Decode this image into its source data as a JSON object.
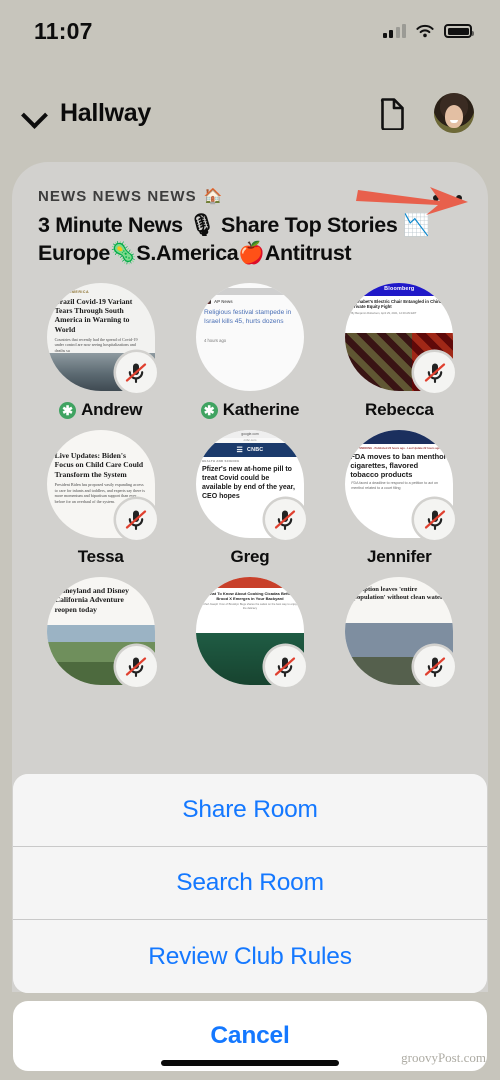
{
  "status_bar": {
    "time": "11:07",
    "signal_icon": "cellular-bars-icon",
    "wifi_icon": "wifi-icon",
    "battery_icon": "battery-full-icon"
  },
  "nav": {
    "chevron_icon": "chevron-down-icon",
    "room_label": "Hallway",
    "document_icon": "document-icon",
    "avatar_icon": "user-avatar"
  },
  "room": {
    "club_name": "NEWS NEWS NEWS",
    "club_house_emoji": "🏠",
    "title": "3 Minute News 🎙 Share Top Stories 📉Europe🦠S.America🍎Antitrust",
    "more_icon": "ellipsis-more-icon",
    "arrow_annotation_color": "#e8604c",
    "club_badge_color": "#3fa361",
    "accent_color": "#1478ff"
  },
  "participants": [
    {
      "name": "Andrew",
      "club_member": true,
      "muted": true,
      "card": {
        "kicker": "LATIN AMERICA",
        "headline": "Brazil Covid-19 Variant Tears Through South America in Warning to World",
        "body": "Countries that recently had the spread of Covid-19 under control are now seeing hospitalizations and deaths su",
        "style": "serif"
      }
    },
    {
      "name": "Katherine",
      "club_member": true,
      "muted": false,
      "card": {
        "source": "AP News",
        "headline": "Religious festival stampede in Israel kills 45, hurts dozens",
        "timestamp": "4 hours ago",
        "style": "link"
      }
    },
    {
      "name": "Rebecca",
      "club_member": false,
      "muted": true,
      "card": {
        "brand": "Bloomberg",
        "headline": "Alphabet's Electric Chair Entangled in China Private Equity Fight",
        "byline": "By Benjamin Robertson, April 29, 2021, 12:00 AM EDT",
        "style": "photo"
      }
    },
    {
      "name": "Tessa",
      "club_member": false,
      "muted": true,
      "card": {
        "headline": "Live Updates: Biden's Focus on Child Care Could Transform the System",
        "body": "President Biden has proposed vastly expanding access to care for infants and toddlers, and experts say there is more momentum and bipartisan support than ever before for an overhaul of the system.",
        "style": "serif"
      }
    },
    {
      "name": "Greg",
      "club_member": false,
      "muted": true,
      "card": {
        "urlbar": "google.com",
        "subbar": "cnbc.com",
        "brand": "CNBC",
        "kicker": "HEALTH AND SCIENCE",
        "headline": "Pfizer's new at-home pill to treat Covid could be available by end of the year, CEO hopes",
        "style": "cnbc"
      }
    },
    {
      "name": "Jennifer",
      "club_member": false,
      "muted": true,
      "card": {
        "brand": "NEWS",
        "kicker": "STOP SMOKING · Published 23 hours ago · Last Update 22 hours ago",
        "headline": "FDA moves to ban menthol cigarettes, flavored tobacco products",
        "body": "FDA faced a deadline to respond to a petition to act on menthol related to a court filing",
        "style": "fox"
      }
    },
    {
      "name": "",
      "club_member": false,
      "muted": true,
      "card": {
        "headline": "Disneyland and Disney California Adventure reopen today",
        "style": "photo-serif"
      }
    },
    {
      "name": "",
      "club_member": false,
      "muted": true,
      "card": {
        "headline": "What To Know About Cooking Cicadas Before Brood X Emerges in Your Backyard",
        "byline": "Chef Joseph Yoon of Brooklyn Bugs shares the safest on the best way to enjoy the delicacy",
        "style": "photo-center"
      }
    },
    {
      "name": "",
      "club_member": false,
      "muted": true,
      "card": {
        "headline": "Eruption leaves 'entire population' without clean water",
        "style": "photo-volcano"
      }
    }
  ],
  "action_sheet": {
    "items": [
      {
        "label": "Share Room",
        "name": "share-room"
      },
      {
        "label": "Search Room",
        "name": "search-room"
      },
      {
        "label": "Review Club Rules",
        "name": "review-club-rules"
      }
    ],
    "cancel_label": "Cancel"
  },
  "watermark": "groovyPost.com"
}
